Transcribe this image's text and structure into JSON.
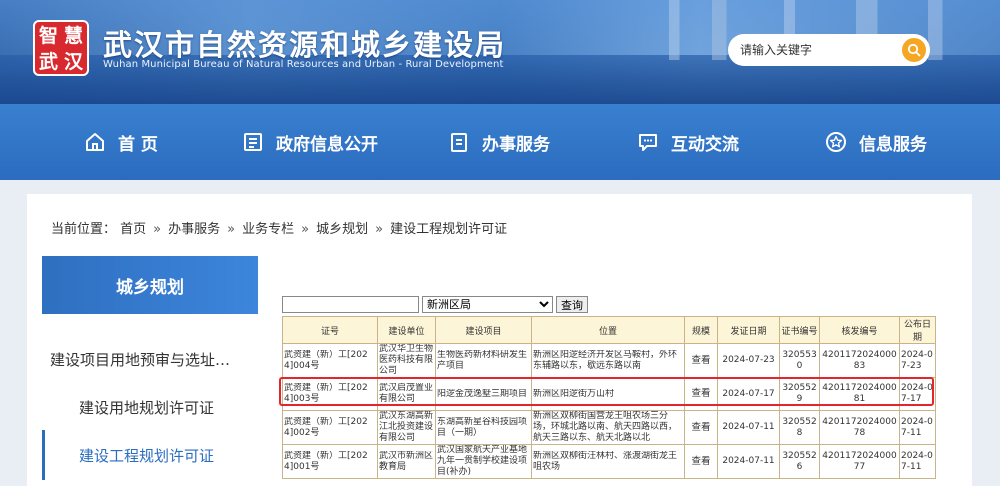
{
  "header": {
    "logo_chars": [
      "智",
      "慧",
      "武",
      "汉"
    ],
    "title": "武汉市自然资源和城乡建设局",
    "subtitle": "Wuhan Municipal Bureau of Natural Resources and Urban - Rural Development",
    "search_placeholder": "请输入关键字"
  },
  "nav": {
    "items": [
      {
        "label": "首 页",
        "icon": "home-icon"
      },
      {
        "label": "政府信息公开",
        "icon": "document-icon"
      },
      {
        "label": "办事服务",
        "icon": "clipboard-icon"
      },
      {
        "label": "互动交流",
        "icon": "chat-icon"
      },
      {
        "label": "信息服务",
        "icon": "star-icon"
      }
    ]
  },
  "breadcrumb": {
    "prefix": "当前位置：",
    "items": [
      "首页",
      "办事服务",
      "业务专栏",
      "城乡规划",
      "建设工程规划许可证"
    ],
    "separator": "»"
  },
  "sidebar": {
    "title": "城乡规划",
    "items": [
      {
        "label": "建设项目用地预审与选址…",
        "active": false
      },
      {
        "label": "建设用地规划许可证",
        "active": false
      },
      {
        "label": "建设工程规划许可证",
        "active": true
      }
    ]
  },
  "filter": {
    "input_value": "",
    "select_value": "新洲区局",
    "search_button": "查询"
  },
  "table": {
    "headers": [
      "证号",
      "建设单位",
      "建设项目",
      "位置",
      "规模",
      "发证日期",
      "证书编号",
      "核发编号",
      "公布日期"
    ],
    "rows": [
      [
        "武资建（新）工[2024]004号",
        "武汉华卫生物医药科技有限公司",
        "生物医药新材料研发生产项目",
        "新洲区阳逻经济开发区马鞍村，外环东辅路以东，歇远东路以南",
        "查看",
        "2024-07-23",
        "3205530",
        "420117202400083",
        "2024-07-23"
      ],
      [
        "武资建（新）工[2024]003号",
        "武汉启茂置业有限公司",
        "阳逻金茂逸墅三期项目",
        "新洲区阳逻街万山村",
        "查看",
        "2024-07-17",
        "3205529",
        "420117202400081",
        "2024-07-17"
      ],
      [
        "武资建（新）工[2024]002号",
        "武汉东湖高新江北投资建设有限公司",
        "东湖高新星谷科技园项目（一期）",
        "新洲区双柳街国营龙王咀农场三分场，环城北路以南、航天四路以西，航天三路以东、航天北路以北",
        "查看",
        "2024-07-11",
        "3205528",
        "420117202400078",
        "2024-07-11"
      ],
      [
        "武资建（新）工[2024]001号",
        "武汉市新洲区教育局",
        "武汉国家航天产业基地九年一贯制学校建设项目(补办)",
        "新洲区双柳街汪林村、涨渡湖街龙王咀农场",
        "查看",
        "2024-07-11",
        "3205526",
        "420117202400077",
        "2024-07-11"
      ]
    ],
    "highlighted_row": 1
  },
  "colors": {
    "nav_bg": "#2b6cbf",
    "accent_orange": "#f5a623",
    "highlight_red": "#e3262b",
    "table_header_bg": "#fdf5d8"
  }
}
